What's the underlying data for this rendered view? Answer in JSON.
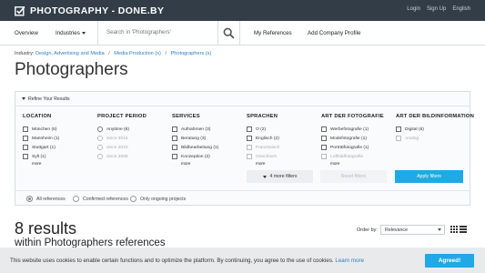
{
  "header": {
    "logo_text": "PHOTOGRAPHY - DONE.BY",
    "logo_icon": "checkbox-icon",
    "links": [
      "Login",
      "Sign Up",
      "English"
    ]
  },
  "nav": {
    "overview": "Overview",
    "industries": "Industries",
    "search_placeholder": "Search in 'Photographers'",
    "search_icon": "search-icon",
    "my_references": "My References",
    "add_company_profile": "Add Company Profile"
  },
  "breadcrumb": {
    "label": "Industry:",
    "items": [
      "Design, Advertising and Media",
      "Media Production (s)",
      "Photographers (s)"
    ],
    "separator": "/"
  },
  "page_title": "Photographers",
  "filters": {
    "refine_label": "Refine Your Results",
    "columns": [
      {
        "title": "LOCATION",
        "options": [
          {
            "label": "München (6)",
            "disabled": false
          },
          {
            "label": "Mannheim (1)",
            "disabled": false
          },
          {
            "label": "Stuttgart (1)",
            "disabled": false
          },
          {
            "label": "Sylt (1)",
            "disabled": false
          }
        ],
        "more": "more"
      },
      {
        "title": "PROJECT PERIOD",
        "options": [
          {
            "label": "Anytime (8)",
            "disabled": false
          },
          {
            "label": "since 2015",
            "disabled": true
          },
          {
            "label": "since 2010",
            "disabled": true
          },
          {
            "label": "since 2005",
            "disabled": true
          }
        ],
        "more": ""
      },
      {
        "title": "SERVICES",
        "options": [
          {
            "label": "Aufnahmen (3)",
            "disabled": false
          },
          {
            "label": "Beratung (3)",
            "disabled": false
          },
          {
            "label": "Bildbearbeitung (1)",
            "disabled": false
          },
          {
            "label": "Konzeption (2)",
            "disabled": false
          }
        ],
        "more": "more"
      },
      {
        "title": "SPRACHEN",
        "options": [
          {
            "label": "O (2)",
            "disabled": false
          },
          {
            "label": "Englisch (2)",
            "disabled": false
          },
          {
            "label": "Französisch",
            "disabled": true
          },
          {
            "label": "Griechisch",
            "disabled": true
          }
        ],
        "more": "more"
      },
      {
        "title": "ART DER FOTOGRAFIE",
        "options": [
          {
            "label": "Werbefotografie (1)",
            "disabled": false
          },
          {
            "label": "Modefotografie (1)",
            "disabled": false
          },
          {
            "label": "Porträtfotografie (1)",
            "disabled": false
          },
          {
            "label": "Luftbildfotografie",
            "disabled": true
          }
        ],
        "more": "more"
      },
      {
        "title": "ART DER BILDINFORMATION",
        "options": [
          {
            "label": "Digital (6)",
            "disabled": false
          },
          {
            "label": "Analog",
            "disabled": true
          }
        ],
        "more": ""
      }
    ],
    "more_filters": "4 more filters",
    "reset_filters": "Reset filters",
    "apply_filters": "Apply filters",
    "reference_options": [
      "All references",
      "Confirmed references",
      "Only ongoing projects"
    ]
  },
  "results": {
    "count": "8 results",
    "subtitle": "within Photographers references",
    "order_by_label": "Order by:",
    "order_by_value": "Relevance",
    "grid_view_icon": "grid-view-icon",
    "list_view_icon": "list-view-icon"
  },
  "cookie": {
    "text": "This website uses cookies to enable certain functions and to optimize the platform. By continuing, you agree to the use of cookies.",
    "learn_more": "Learn more",
    "accept": "Agreed!"
  },
  "colors": {
    "topbar": "#333d47",
    "accent": "#1fa9e6",
    "link": "#2c7fc4"
  }
}
